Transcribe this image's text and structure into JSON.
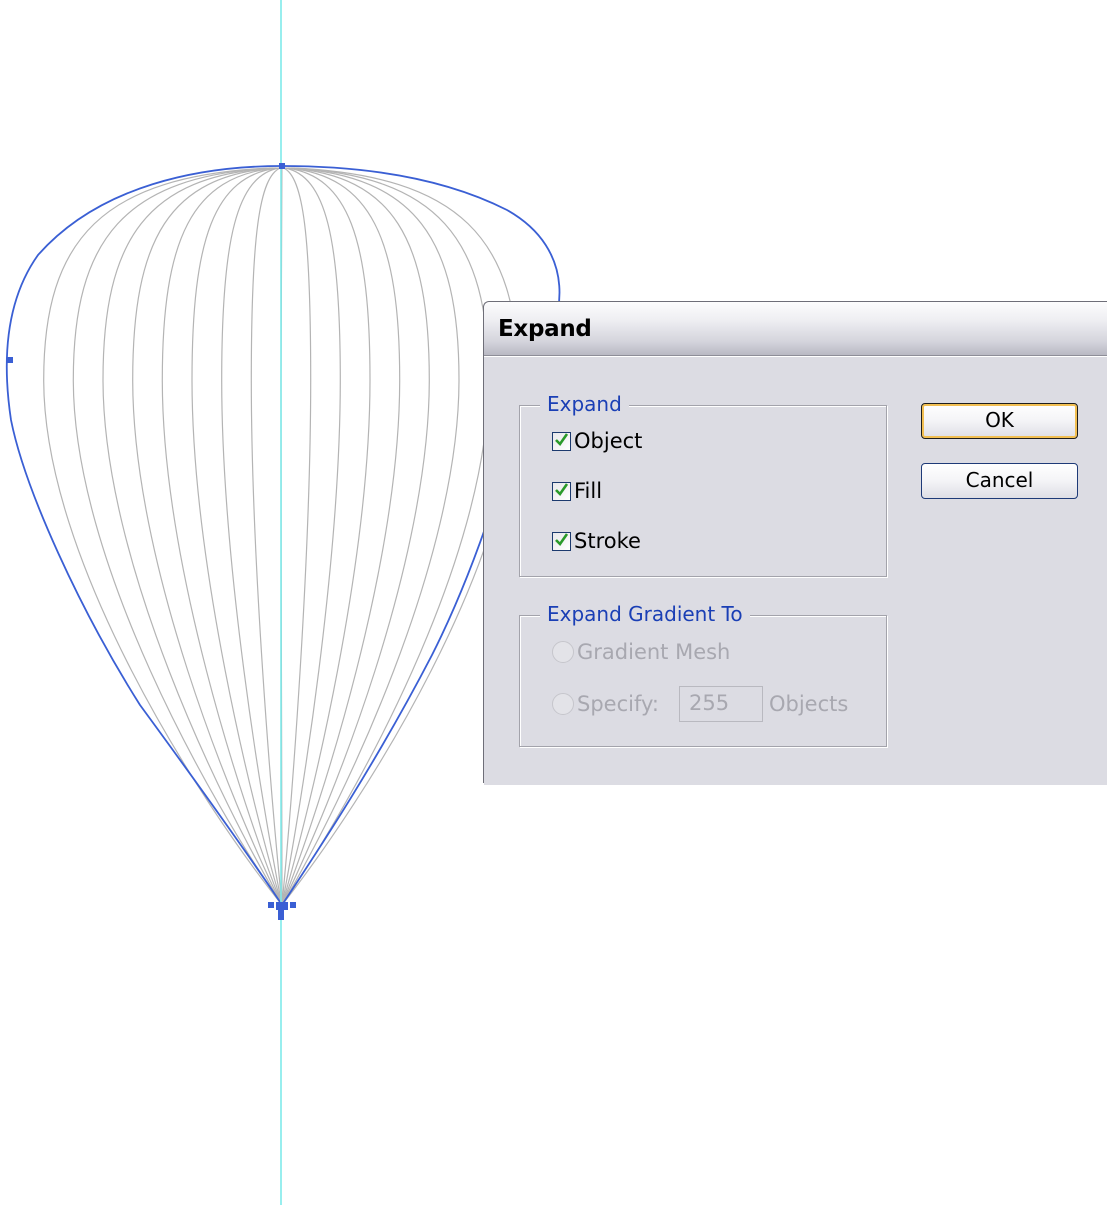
{
  "dialog": {
    "title": "Expand",
    "expand_group": {
      "legend": "Expand",
      "options": [
        {
          "label": "Object",
          "checked": true
        },
        {
          "label": "Fill",
          "checked": true
        },
        {
          "label": "Stroke",
          "checked": true
        }
      ]
    },
    "gradient_group": {
      "legend": "Expand Gradient To",
      "gradient_mesh_label": "Gradient Mesh",
      "specify_label": "Specify:",
      "specify_value": "255",
      "objects_label": "Objects",
      "enabled": false
    },
    "buttons": {
      "ok_label": "OK",
      "cancel_label": "Cancel"
    }
  },
  "colors": {
    "guide": "#7fe9e9",
    "selection_path": "#3a5fd4",
    "gore_lines": "#b4b4b4",
    "legend_text": "#1a3fb5",
    "checkmark": "#2a9a2a",
    "default_button_ring": "#f2bf52"
  }
}
